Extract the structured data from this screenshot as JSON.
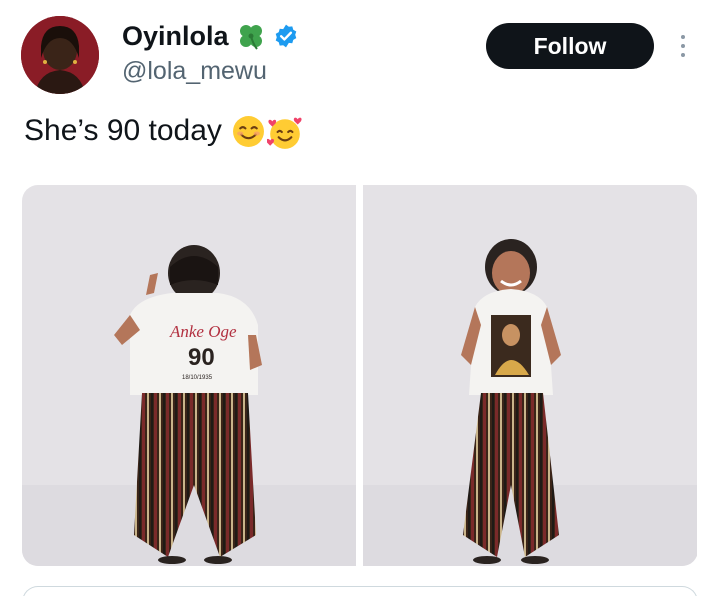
{
  "author": {
    "display_name": "Oyinlola",
    "handle": "@lola_mewu",
    "name_emoji_icon": "four-leaf-clover-icon",
    "verified_icon": "verified-badge-icon"
  },
  "actions": {
    "follow_label": "Follow",
    "more_icon": "more-vertical-icon"
  },
  "tweet": {
    "text": "She’s 90 today",
    "emojis": [
      "smiling-face-with-smiling-eyes-icon",
      "smiling-face-with-hearts-icon"
    ]
  },
  "media": {
    "photos": [
      {
        "name": "photo-back-view",
        "shirt_text_line1": "Anke Oge",
        "shirt_text_line2": "90",
        "shirt_text_line3": "18/10/1935"
      },
      {
        "name": "photo-front-view"
      }
    ]
  },
  "colors": {
    "follow_bg": "#0f1419",
    "handle": "#536471",
    "verified": "#1d9bf0",
    "photo_backdrop": "#e2e0e4"
  }
}
